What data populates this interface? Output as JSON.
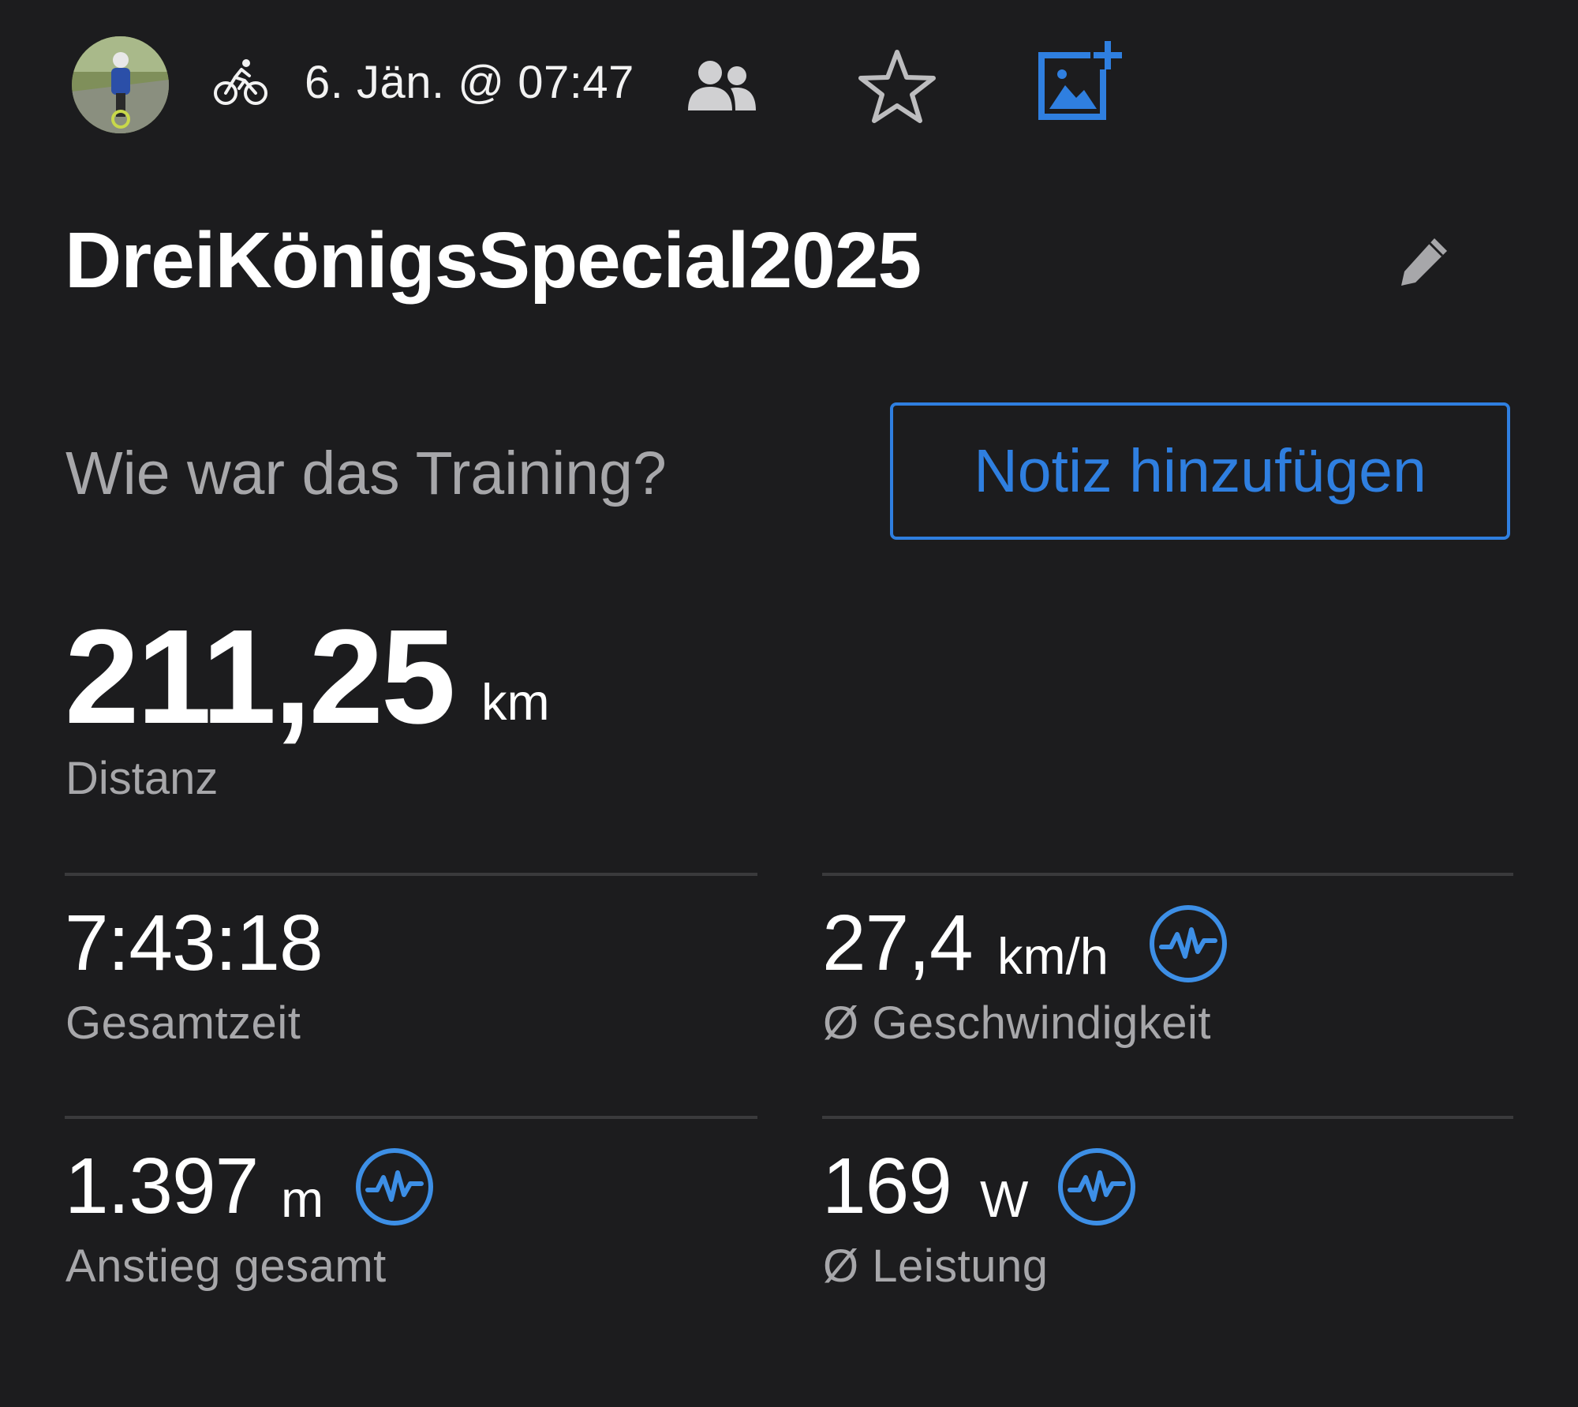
{
  "header": {
    "date_time": "6. Jän. @ 07:47",
    "icons": [
      "avatar",
      "bike-icon",
      "group-icon",
      "star-icon",
      "add-photo-icon"
    ]
  },
  "activity": {
    "title": "DreiKönigsSpecial2025",
    "edit_icon": "pencil-icon"
  },
  "feedback": {
    "question": "Wie war das Training?",
    "note_button": "Notiz hinzufügen"
  },
  "distance": {
    "value": "211,25",
    "unit": "km",
    "label": "Distanz"
  },
  "stats": {
    "total_time": {
      "value": "7:43:18",
      "unit": "",
      "label": "Gesamtzeit"
    },
    "avg_speed": {
      "value": "27,4",
      "unit": "km/h",
      "label": "Ø Geschwindigkeit",
      "icon": "performance-icon"
    },
    "ascent": {
      "value": "1.397",
      "unit": "m",
      "label": "Anstieg gesamt",
      "icon": "performance-icon"
    },
    "avg_power": {
      "value": "169",
      "unit": "W",
      "label": "Ø Leistung",
      "icon": "performance-icon"
    }
  },
  "colors": {
    "background": "#1c1c1e",
    "accent": "#2f7fe0",
    "secondary_text": "#a7a7aa",
    "divider": "#3a3a3c"
  }
}
